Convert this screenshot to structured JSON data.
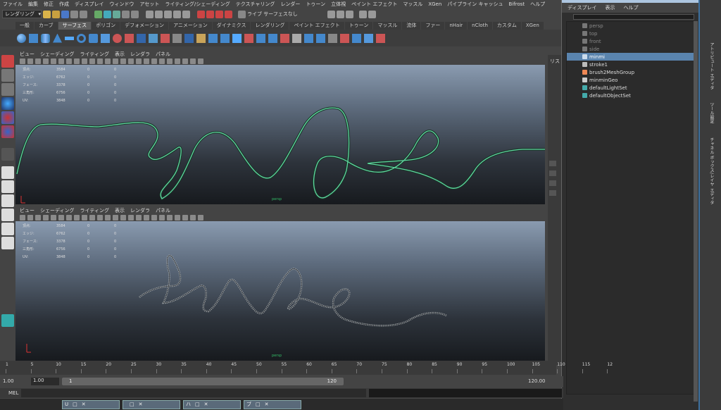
{
  "menubar": [
    "ファイル",
    "編集",
    "修正",
    "作成",
    "ディスプレイ",
    "ウィンドウ",
    "アセット",
    "ライティング/シェーディング",
    "テクスチャリング",
    "レンダー",
    "トゥーン",
    "立体視",
    "ペイント エフェクト",
    "マッスル",
    "XGen",
    "パイプライン キャッシュ",
    "Bifrost",
    "ヘルプ"
  ],
  "status": {
    "mode": "レンダリング",
    "live_label": "ライブ サーフェスなし"
  },
  "shelf_tabs": [
    "一般",
    "カーブ",
    "サーフェス",
    "ポリゴン",
    "デフォメーション",
    "アニメーション",
    "ダイナミクス",
    "レンダリング",
    "ペイント エフェクト",
    "トゥーン",
    "マッスル",
    "流体",
    "ファー",
    "nHair",
    "nCloth",
    "カスタム",
    "XGen"
  ],
  "shelf_active": 2,
  "viewport_menu": [
    "ビュー",
    "シェーディング",
    "ライティング",
    "表示",
    "レンダラ",
    "パネル"
  ],
  "hud_rows": [
    {
      "k": "頂点:",
      "a": "3584",
      "b": "0",
      "c": "0"
    },
    {
      "k": "エッジ:",
      "a": "6762",
      "b": "0",
      "c": "0"
    },
    {
      "k": "フェース:",
      "a": "3378",
      "b": "0",
      "c": "0"
    },
    {
      "k": "三角形:",
      "a": "6756",
      "b": "0",
      "c": "0"
    },
    {
      "k": "UV:",
      "a": "3848",
      "b": "0",
      "c": "0"
    }
  ],
  "cam_top": "persp",
  "cam_bottom": "persp",
  "rightstrip": {
    "label": "リスト"
  },
  "outliner": {
    "menu": [
      "ディスプレイ",
      "表示",
      "ヘルプ"
    ],
    "items": [
      {
        "label": "persp",
        "dim": true,
        "icon": "camera-icon"
      },
      {
        "label": "top",
        "dim": true,
        "icon": "camera-icon"
      },
      {
        "label": "front",
        "dim": true,
        "icon": "camera-icon"
      },
      {
        "label": "side",
        "dim": true,
        "icon": "camera-icon"
      },
      {
        "label": "minmi",
        "sel": true,
        "icon": "curve-icon"
      },
      {
        "label": "stroke1",
        "icon": "stroke-icon"
      },
      {
        "label": "brush2MeshGroup",
        "icon": "group-icon"
      },
      {
        "label": "minminGeo",
        "icon": "mesh-icon"
      },
      {
        "label": "defaultLightSet",
        "icon": "set-icon"
      },
      {
        "label": "defaultObjectSet",
        "icon": "set-icon"
      }
    ]
  },
  "side_tabs": [
    "アトリビュート エディタ",
    "ツール設定",
    "チャネル ボックス/レイヤ エディタ"
  ],
  "timeline": {
    "ticks": [
      "1",
      "5",
      "10",
      "15",
      "20",
      "25",
      "30",
      "35",
      "40",
      "45",
      "50",
      "55",
      "60",
      "65",
      "70",
      "75",
      "80",
      "85",
      "90",
      "95",
      "100",
      "105",
      "110",
      "115",
      "12"
    ]
  },
  "range": {
    "start": "1.00",
    "start2": "1.00",
    "slider_start": "1",
    "slider_end": "120",
    "end": "120.00"
  },
  "cmd": {
    "label": "MEL"
  },
  "taskbar": [
    "U",
    "",
    "ハ",
    "ブ"
  ]
}
